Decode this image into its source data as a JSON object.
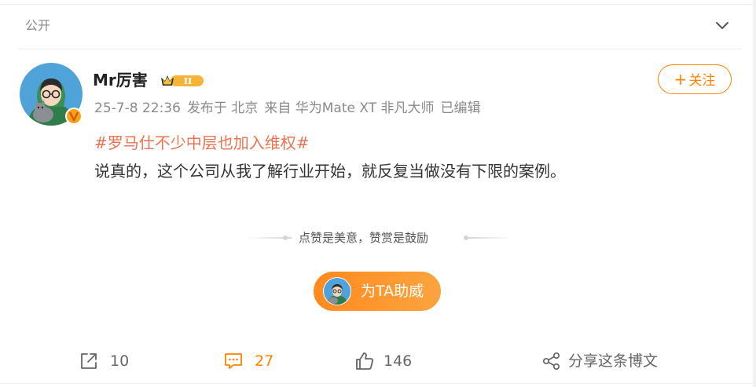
{
  "post": {
    "visibility": "公开",
    "author": {
      "name": "Mr厉害",
      "level_badge": "II"
    },
    "meta": {
      "time": "25-7-8 22:36",
      "location": "发布于 北京",
      "source": "来自 华为Mate XT 非凡大师",
      "edited": "已编辑"
    },
    "follow_label": "关注",
    "follow_plus": "+",
    "topic": "#罗马仕不少中层也加入维权#",
    "body": "说真的，这个公司从我了解行业开始，就反复当做没有下限的案例。"
  },
  "reward": {
    "slogan": "点赞是美意，赞赏是鼓励",
    "button_label": "为TA助威"
  },
  "actions": {
    "repost_count": "10",
    "comment_count": "27",
    "like_count": "146",
    "share_label": "分享这条博文"
  },
  "colors": {
    "accent": "#ff8200",
    "topic": "#eb7350",
    "text": "#333333",
    "muted": "#8a8a8a"
  },
  "icons": {
    "collapse": "chevron-down-icon",
    "repost": "repost-icon",
    "comment": "comment-icon",
    "like": "thumbs-up-icon",
    "share": "share-icon",
    "verify": "verified-badge-icon"
  }
}
